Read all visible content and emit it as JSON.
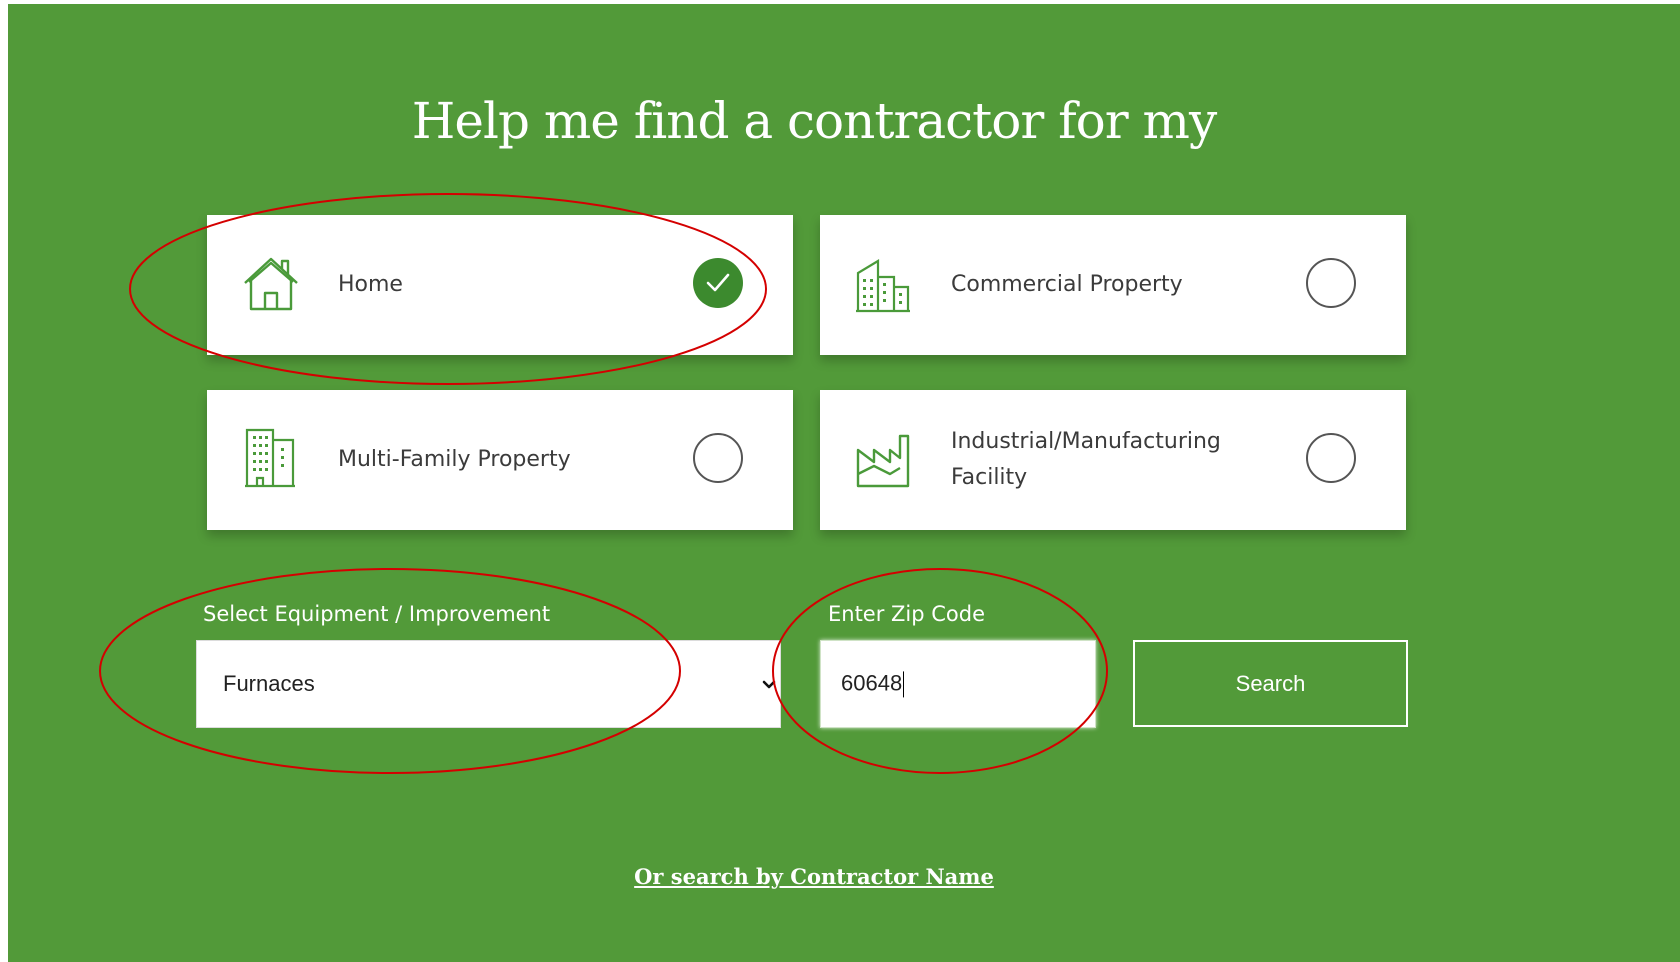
{
  "page": {
    "headline": "Help me find a contractor for my"
  },
  "property_options": [
    {
      "label": "Home",
      "icon": "house-icon",
      "selected": true
    },
    {
      "label": "Commercial Property",
      "icon": "commercial-building-icon",
      "selected": false
    },
    {
      "label": "Multi-Family Property",
      "icon": "apartment-building-icon",
      "selected": false
    },
    {
      "label": "Industrial/Manufacturing Facility",
      "icon": "factory-icon",
      "selected": false
    }
  ],
  "equipment": {
    "label": "Select Equipment / Improvement",
    "value": "Furnaces"
  },
  "zip": {
    "label": "Enter Zip Code",
    "value": "60648"
  },
  "search_button": {
    "label": "Search"
  },
  "contractor_link": {
    "label": "Or search by Contractor Name"
  },
  "colors": {
    "background_green": "#529a39",
    "check_green": "#3c8a2e",
    "icon_green": "#4a9a3a",
    "annotation_red": "#d40000"
  }
}
